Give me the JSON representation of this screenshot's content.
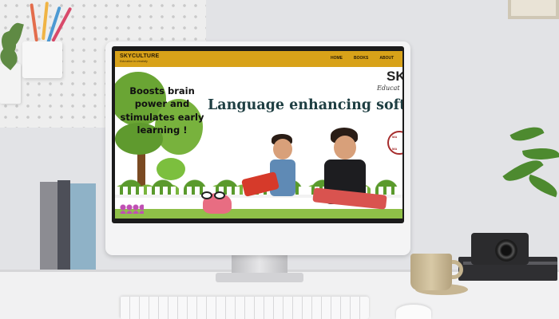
{
  "site": {
    "logo_name": "SKYCULTURE",
    "logo_tagline": "Education in creativity",
    "nav": [
      "HOME",
      "BOOKS",
      "ABOUT"
    ]
  },
  "hero": {
    "slogan_lines": [
      "Boosts brain",
      "power and",
      "stimulates  early",
      "learning !"
    ],
    "headline": "Language enhancing soft fabric",
    "brand_partial": "SK",
    "brand_script_partial": "Educat",
    "badge_top": "MA",
    "badge_bottom": "MA"
  },
  "colors": {
    "header": "#d8a219",
    "headline": "#1e3e42",
    "grass": "#8fc048"
  }
}
